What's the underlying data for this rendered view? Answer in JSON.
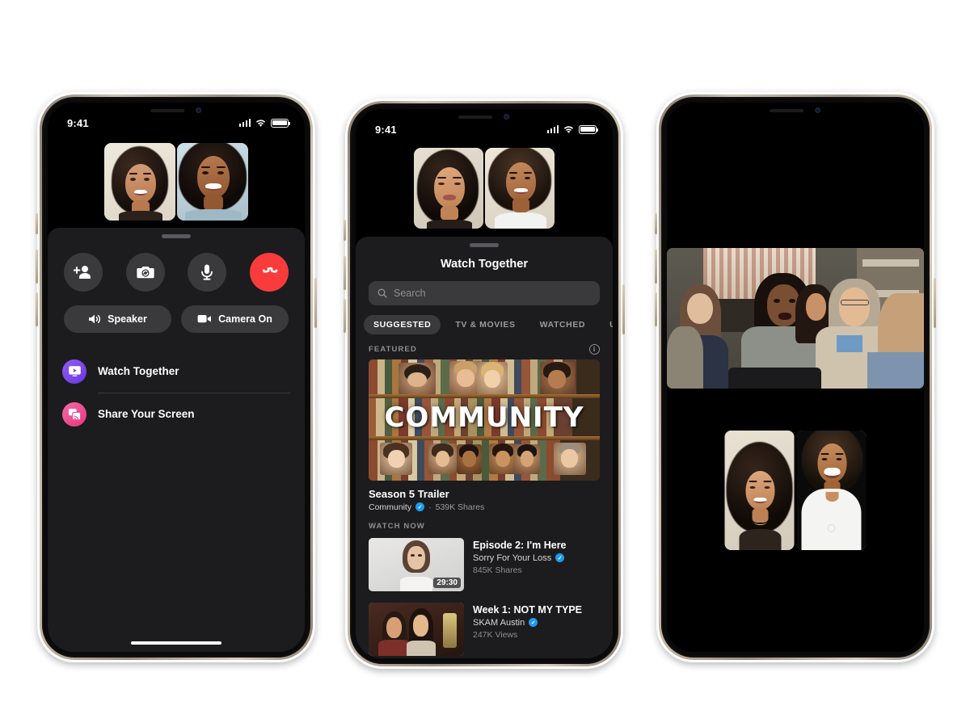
{
  "meta": {
    "scene": "Facebook Messenger Watch Together promo — three iPhone mockups",
    "background_color": "#ffffff",
    "accent_purple": "#7B4DE8",
    "accent_pink": "#F0518A",
    "accent_red": "#FA3B3B",
    "accent_blue": "#1D9BF0",
    "panel_bg": "#1C1C1E",
    "control_bg": "#3A3A3C"
  },
  "status_bar": {
    "time": "9:41",
    "signal_icon": "cellular-bars-icon",
    "wifi_icon": "wifi-icon",
    "battery_icon": "battery-full-icon"
  },
  "phone1": {
    "name": "video-call-controls",
    "participants": [
      {
        "name": "participant-tile-1",
        "label": "Participant 1"
      },
      {
        "name": "participant-tile-2",
        "label": "Participant 2"
      }
    ],
    "drag_handle": "sheet-drag-handle",
    "controls": [
      {
        "id": "add-person",
        "icon": "add-person-icon",
        "label": "Add Person"
      },
      {
        "id": "flip-camera",
        "icon": "flip-camera-icon",
        "label": "Flip Camera"
      },
      {
        "id": "mute",
        "icon": "microphone-icon",
        "label": "Mute"
      },
      {
        "id": "end-call",
        "icon": "end-call-icon",
        "label": "End Call"
      }
    ],
    "toggles": [
      {
        "id": "speaker",
        "icon": "speaker-icon",
        "label": "Speaker"
      },
      {
        "id": "camera",
        "icon": "video-camera-icon",
        "label": "Camera On"
      }
    ],
    "menu": [
      {
        "id": "watch-together",
        "icon": "watch-together-icon",
        "label": "Watch Together",
        "color": "#7B4DE8"
      },
      {
        "id": "share-screen",
        "icon": "share-screen-icon",
        "label": "Share Your Screen",
        "color": "#F0518A"
      }
    ]
  },
  "phone2": {
    "name": "watch-together-browser",
    "sheet_title": "Watch Together",
    "search": {
      "placeholder": "Search",
      "value": "",
      "icon": "search-icon"
    },
    "tabs": [
      {
        "label": "SUGGESTED",
        "active": true
      },
      {
        "label": "TV & MOVIES",
        "active": false
      },
      {
        "label": "WATCHED",
        "active": false
      },
      {
        "label": "U",
        "active": false
      }
    ],
    "featured_section": {
      "heading": "FEATURED",
      "info_icon": "info-circle-icon",
      "poster_title": "COMMUNITY",
      "title": "Season 5 Trailer",
      "channel": "Community",
      "verified": true,
      "separator": "·",
      "stats": "539K Shares"
    },
    "watch_now_section": {
      "heading": "WATCH NOW",
      "items": [
        {
          "title": "Episode 2: I'm Here",
          "channel": "Sorry For Your Loss",
          "verified": true,
          "stats": "845K Shares",
          "duration": "29:30"
        },
        {
          "title": "Week 1: NOT MY TYPE",
          "channel": "SKAM Austin",
          "verified": true,
          "stats": "247K Views",
          "duration": ""
        }
      ]
    }
  },
  "phone3": {
    "name": "co-watching-fullscreen",
    "video_label": "Community episode playback",
    "pips": [
      {
        "name": "pip-tile-1",
        "label": "Participant 1"
      },
      {
        "name": "pip-tile-2",
        "label": "Participant 2"
      }
    ]
  }
}
